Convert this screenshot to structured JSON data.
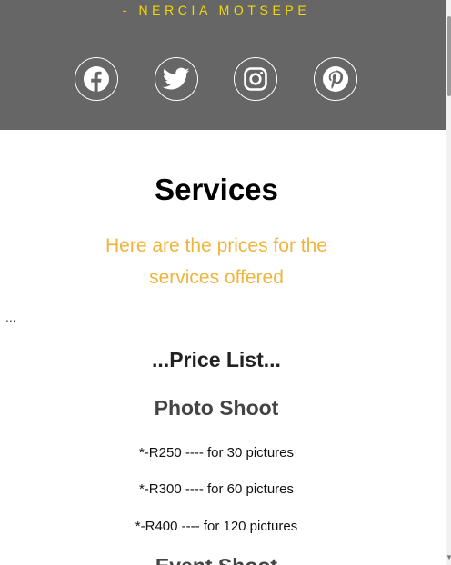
{
  "header": {
    "tagline": "- NERCIA MOTSEPE",
    "social": [
      {
        "name": "facebook",
        "icon": "facebook-icon"
      },
      {
        "name": "twitter",
        "icon": "twitter-icon"
      },
      {
        "name": "instagram",
        "icon": "instagram-icon"
      },
      {
        "name": "pinterest",
        "icon": "pinterest-icon"
      }
    ],
    "background_color": "#666666",
    "tagline_color": "#f5d800"
  },
  "main": {
    "title": "Services",
    "subtitle_line1": "Here are the prices for the",
    "subtitle_line2": "services offered",
    "subtitle_color": "#f0b43c",
    "ellipsis": "...",
    "price_list_heading": "...Price List...",
    "sections": [
      {
        "heading": "Photo Shoot",
        "items": [
          "*-R250 ---- for 30 pictures",
          "*-R300 ---- for 60 pictures",
          "*-R400 ---- for 120 pictures"
        ]
      },
      {
        "heading": "Event Shoot"
      }
    ]
  }
}
